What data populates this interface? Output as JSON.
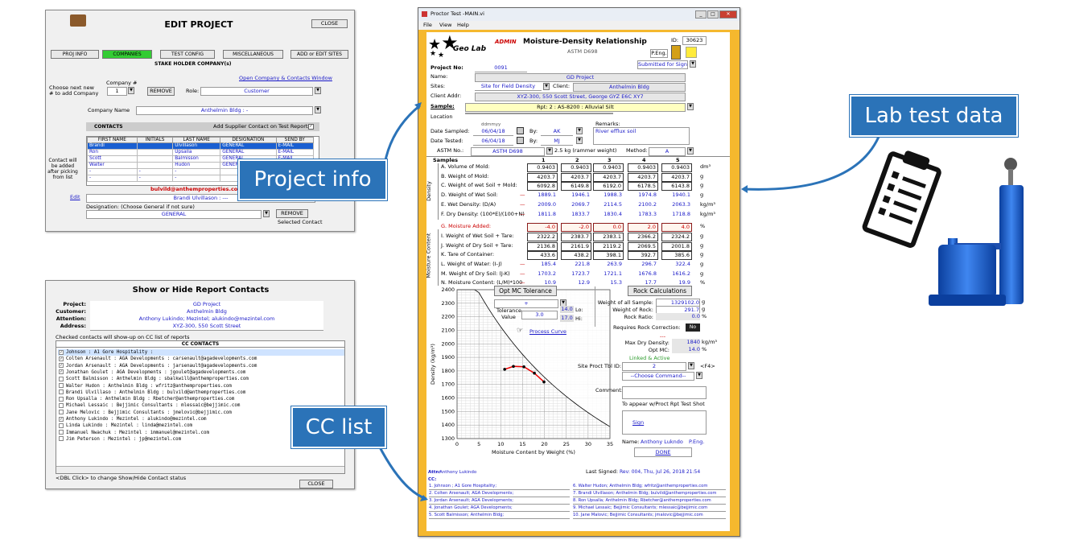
{
  "edit_project": {
    "title": "EDIT PROJECT",
    "close": "CLOSE",
    "tabs": [
      "PROJ INFO",
      "COMPANIES",
      "TEST CONFIG",
      "MISCELLANEOUS",
      "ADD or EDIT SITES"
    ],
    "section": "STAKE HOLDER COMPANY(s)",
    "open_link": "Open Company & Contacts Window",
    "choose_text": "Choose next new # to add Company",
    "company_no_label": "Company #",
    "company_no": "1",
    "remove": "REMOVE",
    "role_label": "Role:",
    "role": "Customer",
    "company_name_label": "Company Name",
    "company_name": "Anthelmin Bldg             : -",
    "contacts_label": "CONTACTS",
    "supplier_label": "Add Supplier Contact on Test Reports:",
    "contact_cols": [
      "FIRST NAME",
      "INITIALS",
      "LAST NAME",
      "DESIGNATION",
      "SEND BY"
    ],
    "contacts": [
      [
        "Brandi",
        "",
        "Ulvillason",
        "GENERAL",
        "E-MAIL"
      ],
      [
        "Ron",
        "",
        "Upsalla",
        "GENERAL",
        "E-MAIL"
      ],
      [
        "Scott",
        "",
        "Balmisson",
        "GENERAL",
        "E-MAIL"
      ],
      [
        "Walter",
        "",
        "Hudon",
        "GENERAL",
        "E-MAIL"
      ],
      [
        "-",
        "-",
        "-",
        "",
        ""
      ],
      [
        "-",
        "-",
        "-",
        "",
        ""
      ]
    ],
    "contact_note": "Contact will be added after picking from list",
    "email": "bulvild@anthemproperties.com",
    "edit": "Edit",
    "selected_contact": "Brandi          Ulvillason       : ---",
    "designation_label": "Designation: (Choose General if not sure)",
    "designation": "GENERAL",
    "remove2": "REMOVE",
    "selected_label": "Selected Contact"
  },
  "report_contacts": {
    "title": "Show or Hide Report Contacts",
    "project_label": "Project:",
    "project": "GD Project",
    "customer_label": "Customer:",
    "customer": "Anthelmin Bldg",
    "attention_label": "Attention:",
    "attention": "Anthony Lukindo; Mezintel; alukindo@mezintel.com",
    "address_label": "Address:",
    "address": "XYZ-300, 550 Scott Street",
    "note": "Checked contacts will show-up on CC list of reports",
    "cc_header": "CC CONTACTS",
    "rows": [
      [
        true,
        "Johnson          : A1 Gore Hospitality       :"
      ],
      [
        true,
        "Colten Arsenault : AGA Developments         : carsenault@agadevelopments.com"
      ],
      [
        true,
        "Jordan Arsenault : AGA Developments         : jarsenault@agadevelopments.com"
      ],
      [
        true,
        "Jonathan Goulet  : AGA Developments         : jgoulet@agadevelopments.com"
      ],
      [
        false,
        "Scott Balmisson  : Anthelmin Bldg           : sbalkwill@anthemproperties.com"
      ],
      [
        false,
        "Walter  Hudon    : Anthelmin Bldg           : wfritz@anthemproperties.com"
      ],
      [
        false,
        "Brandi Ulvillaso : Anthelmin Bldg           : bulvild@anthemproperties.com"
      ],
      [
        false,
        "Ron Upsalla      : Anthelmin Bldg           : Rbetcher@anthemproperties.com"
      ],
      [
        false,
        "Michael Lessaic  : Bejjimic Consultants     : mlessaic@bejjimic.com"
      ],
      [
        false,
        "Jane Melovic     : Bejjimic Consultants     : jmelovic@bejjimic.com"
      ],
      [
        true,
        "Anthony Lukindo  : Mezintel                 : alukindo@mezintel.com"
      ],
      [
        false,
        "Linda Lukindo    : Mezintel                 : linda@mezintel.com"
      ],
      [
        false,
        "Immanuel Nwachuk : Mezintel                 : immanuel@mezintel.com"
      ],
      [
        false,
        "Jim Peterson     : Mezintel                 : jp@mezintel.com"
      ]
    ],
    "footer": "<DBL Click> to change Show/Hide Contact status",
    "close": "CLOSE"
  },
  "main": {
    "window_title": "Proctor Test -MAIN.vi",
    "menu": [
      "File",
      "View",
      "Help"
    ],
    "logo": "Geo Lab",
    "admin": "ADMIN",
    "heading": "Moisture-Density Relationship",
    "standard": "ASTM D698",
    "id_label": "ID:",
    "id": "30623",
    "peng": "P.Eng.",
    "submitted": "Submitted for Sign",
    "project_no_label": "Project No:",
    "project_no": "0091",
    "name_label": "Name:",
    "name": "GD Project",
    "sites_label": "Sites:",
    "site": "Site for Field Density",
    "client_label": "Client:",
    "client": "Anthelmin Bldg",
    "client_addr_label": "Client Addr:",
    "client_addr": "XYZ-300, 550 Scott Street, George GYZ E6C XY7",
    "sample_label": "Sample:",
    "sample": "Rpt: 2        : AS-8200        : Alluvial Silt",
    "location_label": "Location",
    "date_fmt": "ddmmyy",
    "date_sampled_label": "Date Sampled:",
    "date_sampled": "06/04/18",
    "by_label": "By:",
    "by1": "AK",
    "date_tested_label": "Date Tested:",
    "date_tested": "06/04/18",
    "by2": "MJ",
    "remarks_label": "Remarks:",
    "remarks": "River efflux soil",
    "astm_label": "ASTM No.:",
    "astm": "ASTM D698",
    "rammer": "2.5 kg (rammer weight)",
    "method_label": "Method:",
    "method": "A",
    "samples_label": "Samples",
    "sample_nums": [
      "1",
      "2",
      "3",
      "4",
      "5"
    ],
    "density_label": "Density",
    "moisture_label": "Moisture Content",
    "rows": [
      {
        "label": "A. Volume of Mold:",
        "vals": [
          "0.9403",
          "0.9403",
          "0.9403",
          "0.9403",
          "0.9403"
        ],
        "unit": "dm³",
        "type": "in"
      },
      {
        "label": "B. Weight of Mold:",
        "vals": [
          "4203.7",
          "4203.7",
          "4203.7",
          "4203.7",
          "4203.7"
        ],
        "unit": "g",
        "type": "in"
      },
      {
        "label": "C. Weight of wet Soil + Mold:",
        "vals": [
          "6092.8",
          "6149.8",
          "6192.0",
          "6178.5",
          "6143.8"
        ],
        "unit": "g",
        "type": "in"
      },
      {
        "label": "D. Weight of Wet Soil:",
        "vals": [
          "1889.1",
          "1946.1",
          "1988.3",
          "1974.8",
          "1940.1"
        ],
        "unit": "g",
        "type": "calc"
      },
      {
        "label": "E. Wet Density: (D/A)",
        "vals": [
          "2009.0",
          "2069.7",
          "2114.5",
          "2100.2",
          "2063.3"
        ],
        "unit": "kg/m³",
        "type": "calc"
      },
      {
        "label": "F. Dry Density: (100*E)/(100+N)",
        "vals": [
          "1811.8",
          "1833.7",
          "1830.4",
          "1783.3",
          "1718.8"
        ],
        "unit": "kg/m³",
        "type": "calc"
      },
      {
        "label": "G. Moisture Added:",
        "vals": [
          "-4.0",
          "-2.0",
          "0.0",
          "2.0",
          "4.0"
        ],
        "unit": "%",
        "type": "red"
      },
      {
        "label": "I. Weight of Wet Soil + Tare:",
        "vals": [
          "2322.2",
          "2383.7",
          "2383.1",
          "2366.2",
          "2324.2"
        ],
        "unit": "g",
        "type": "in"
      },
      {
        "label": "J. Weight of Dry Soil + Tare:",
        "vals": [
          "2136.8",
          "2161.9",
          "2119.2",
          "2069.5",
          "2001.8"
        ],
        "unit": "g",
        "type": "in"
      },
      {
        "label": "K. Tare of Container:",
        "vals": [
          "433.6",
          "438.2",
          "398.1",
          "392.7",
          "385.6"
        ],
        "unit": "g",
        "type": "in"
      },
      {
        "label": "L. Weight of Water: (I-J)",
        "vals": [
          "185.4",
          "221.8",
          "263.9",
          "296.7",
          "322.4"
        ],
        "unit": "g",
        "type": "calc"
      },
      {
        "label": "M. Weight of Dry Soil: (J-K)",
        "vals": [
          "1703.2",
          "1723.7",
          "1721.1",
          "1676.8",
          "1616.2"
        ],
        "unit": "g",
        "type": "calc"
      },
      {
        "label": "N. Moisture Content: (L/M)*100",
        "vals": [
          "10.9",
          "12.9",
          "15.3",
          "17.7",
          "19.9"
        ],
        "unit": "%",
        "type": "calc"
      }
    ],
    "opt_mc_tol": "Opt MC Tolerance",
    "tol_sel": "+",
    "tol_label": "Tolerance Value",
    "tol_val": "3.0",
    "lo_val": "14.0",
    "lo_label": "Lo:",
    "hi_val": "17.0",
    "hi_label": "Hi:",
    "process_curve": "Process Curve",
    "rock_calc": "Rock Calculations",
    "w_all_label": "Weight of all Sample:",
    "w_all": "1329102.0",
    "w_rock_label": "Weight of Rock:",
    "w_rock": "291.7",
    "rock_ratio_label": "Rock Ratio:",
    "rock_ratio": "0.0",
    "rock_corr_label": "Requires Rock Correction:",
    "rock_corr": "No",
    "dash": "---",
    "max_dd_label": "Max Dry Density:",
    "max_dd": "1840",
    "opt_mc_label": "Opt MC:",
    "opt_mc": "14.0",
    "linked": "Linked & Active",
    "site_tbl_label": "Site Proct Tbl ID:",
    "site_tbl": "2",
    "f4": "<F4>",
    "choose_cmd": "--Choose Command--",
    "comment_label": "Comment:",
    "appear": "To appear w/Proct Rpt Test Shot",
    "sign": "Sign",
    "name2_label": "Name:",
    "signer": "Anthony Lukndo",
    "signer_title": "P.Eng.",
    "done": "DONE",
    "attn_label": "Attn:",
    "attn": "Anthony Lukindo",
    "last_signed_label": "Last Signed:",
    "last_signed": "Rev: 004, Thu, Jul 26, 2018 21:54",
    "cc_label": "CC:",
    "cc": [
      "1. Johnson ; A1 Gore Hospitality;",
      "6. Walter Hudon; Anthelmin Bldg; wfritz@anthemproperties.com",
      "2. Colten Arsenault; AGA Developments;",
      "7. Brandi Ulvillason; Anthelmin Bldg; bulvild@anthemproperties.com",
      "3. Jordan Arsenault; AGA Developments;",
      "8. Ron Upsalla; Anthelmin Bldg; Rbetcher@anthemproperties.com",
      "4. Jonathan Goulet; AGA Developments;",
      "9. Michael Lessaic; Bejjimic Consultants; mlessaic@bejjimic.com",
      "5. Scott Balmisson; Anthelmin Bldg;",
      "10. Jane Malovic; Bejjimic Consultants; jmalovic@bejjimic.com"
    ]
  },
  "chart_data": {
    "type": "line",
    "xlabel": "Moisture Content by Weight (%)",
    "ylabel": "Density (kg/m³)",
    "xlim": [
      0,
      35
    ],
    "ylim": [
      1300,
      2400
    ],
    "xticks": [
      "0",
      "5",
      "10",
      "15",
      "20",
      "25",
      "30",
      "35"
    ],
    "yticks": [
      "1300",
      "1400",
      "1500",
      "1600",
      "1700",
      "1800",
      "1900",
      "2000",
      "2100",
      "2200",
      "2300",
      "2400"
    ],
    "x": [
      10.9,
      12.9,
      15.3,
      17.7,
      19.9
    ],
    "y": [
      1811.8,
      1833.7,
      1830.4,
      1783.3,
      1718.8
    ]
  },
  "callouts": {
    "project_info": "Project info",
    "lab_test_data": "Lab test data",
    "cc_list": "CC list"
  },
  "colors": {
    "callout": "#2b73b8",
    "green_tab": "#33cc33",
    "link": "#1a1ac8",
    "sample_bg": "#ffffc0",
    "frame": "#f5b82e"
  }
}
